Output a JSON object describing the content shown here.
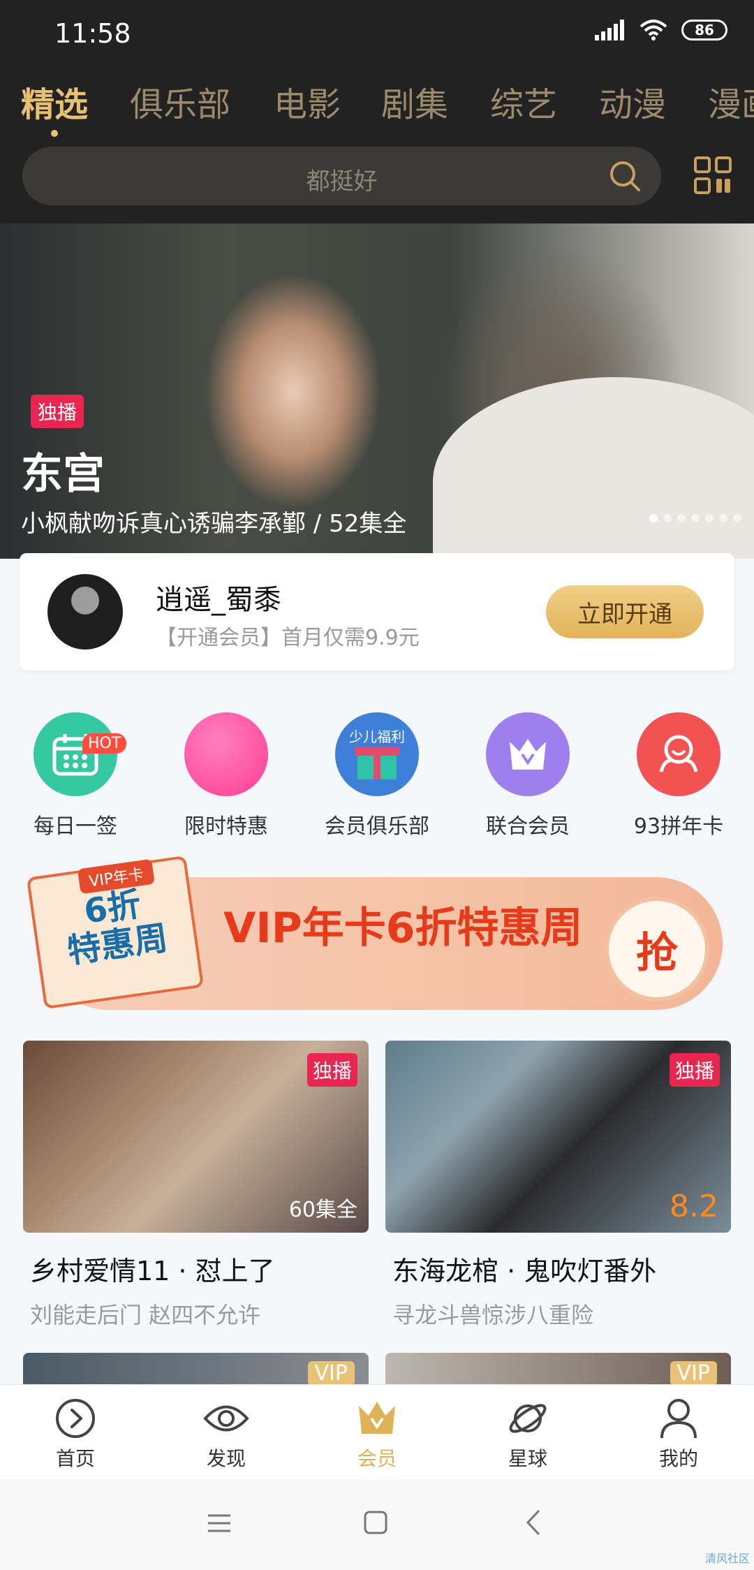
{
  "status_bar": {
    "time": "11:58",
    "battery": "86"
  },
  "tabs": [
    "精选",
    "俱乐部",
    "电影",
    "剧集",
    "综艺",
    "动漫",
    "漫画"
  ],
  "search": {
    "placeholder": "都挺好"
  },
  "hero": {
    "badge": "独播",
    "title": "东宫",
    "subtitle": "小枫献吻诉真心诱骗李承鄞 / 52集全",
    "slide_count": 7,
    "active_slide": 0
  },
  "member": {
    "username": "逍遥_蜀黍",
    "promo": "【开通会员】首月仅需9.9元",
    "button": "立即开通"
  },
  "quick_links": [
    {
      "label": "每日一签",
      "icon": "calendar-icon",
      "color": "#34c9a1",
      "tag": "HOT"
    },
    {
      "label": "限时特惠",
      "icon": "sale-icon",
      "color": "#ff5fa8"
    },
    {
      "label": "会员俱乐部",
      "icon": "gift-icon",
      "color": "#3d7fd9",
      "inner_text": "少儿福利"
    },
    {
      "label": "联合会员",
      "icon": "crown-icon",
      "color": "#9d7ff0"
    },
    {
      "label": "93拼年卡",
      "icon": "face-icon",
      "color": "#f25252"
    }
  ],
  "promo_banner": {
    "calendar_head": "VIP年卡",
    "calendar_text": "6折\n特惠周",
    "headline": "VIP年卡6折特惠周",
    "button": "抢"
  },
  "cards": [
    {
      "badge": "独播",
      "episodes": "60集全",
      "title": "乡村爱情11 · 怼上了",
      "subtitle": "刘能走后门 赵四不允许"
    },
    {
      "badge": "独播",
      "score": "8.2",
      "title": "东海龙棺 · 鬼吹灯番外",
      "subtitle": "寻龙斗兽惊涉八重险"
    }
  ],
  "peek_cards": [
    {
      "badge": "VIP"
    },
    {
      "badge": "VIP"
    }
  ],
  "bottom_nav": [
    {
      "label": "首页",
      "icon": "play-circle-icon"
    },
    {
      "label": "发现",
      "icon": "eye-icon"
    },
    {
      "label": "会员",
      "icon": "crown-icon",
      "active": true
    },
    {
      "label": "星球",
      "icon": "planet-icon"
    },
    {
      "label": "我的",
      "icon": "person-icon"
    }
  ],
  "watermark": "清风社区",
  "colors": {
    "accent": "#e7c072",
    "header_bg": "#222222",
    "badge_red": "#e8264f"
  }
}
